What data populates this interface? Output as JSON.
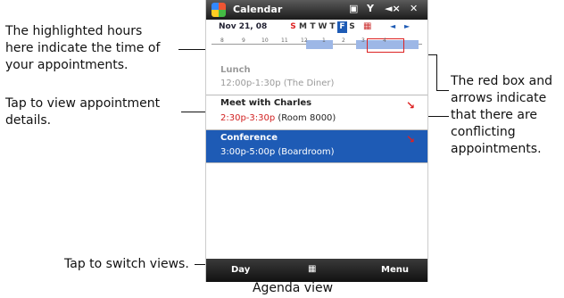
{
  "callouts": {
    "highlighted_hours": [
      "The highlighted hours",
      "here indicate the time of",
      "your appointments."
    ],
    "tap_details": [
      "Tap to view appointment",
      "details."
    ],
    "tap_switch": "Tap to switch views.",
    "conflicts": [
      "The red box and",
      "arrows indicate",
      "that there are",
      "conflicting",
      "appointments."
    ]
  },
  "caption": "Agenda view",
  "phone": {
    "app_title": "Calendar",
    "status_icons": [
      "keyboard-icon",
      "signal-icon",
      "volume-icon",
      "close-icon"
    ],
    "close_glyph": "✕",
    "date": "Nov 21, 08",
    "weekdays": [
      "S",
      "M",
      "T",
      "W",
      "T",
      "F",
      "S"
    ],
    "selected_day_index": 5,
    "hour_labels": [
      "8",
      "9",
      "10",
      "11",
      "12",
      "1",
      "2",
      "3",
      "4"
    ],
    "appointments": [
      {
        "title": "Lunch",
        "time": "12:00p-1:30p",
        "location": "(The Diner)",
        "state": "past"
      },
      {
        "title": "Meet with Charles",
        "time": "2:30p-3:30p",
        "location": "(Room 8000)",
        "state": "conflict"
      },
      {
        "title": "Conference",
        "time": "3:00p-5:00p",
        "location": "(Boardroom)",
        "state": "selected-conflict"
      }
    ],
    "softkeys": {
      "left": "Day",
      "right": "Menu"
    }
  },
  "colors": {
    "accent": "#1e5bb5",
    "conflict": "#d22222",
    "past_text": "#9a9a9a"
  }
}
